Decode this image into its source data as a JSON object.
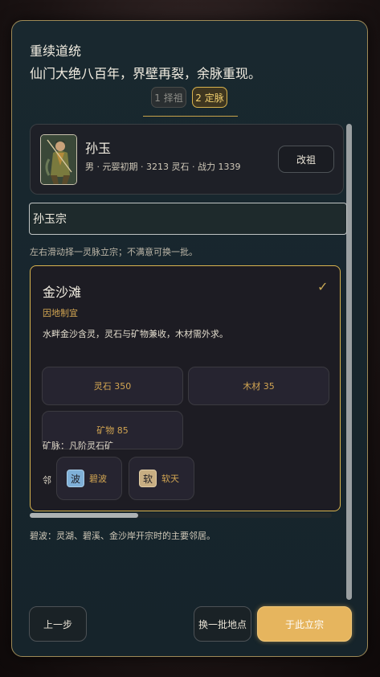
{
  "modal": {
    "title": "重续道统",
    "subtitle": "仙门大绝八百年，界壁再裂，余脉重现。"
  },
  "steps": [
    {
      "label": "1 择祖",
      "active": false
    },
    {
      "label": "2 定脉",
      "active": true
    }
  ],
  "founder": {
    "name": "孙玉",
    "meta": "男 · 元婴初期 · 3213 灵石 · 战力 1339",
    "change_label": "改祖"
  },
  "sect_name_input": {
    "value": "孙玉宗"
  },
  "hint": "左右滑动择一灵脉立宗；不满意可换一批。",
  "site": {
    "name": "金沙滩",
    "selected_mark": "✓",
    "tag": "因地制宜",
    "description": "水畔金沙含灵，灵石与矿物兼收，木材需外求。",
    "resources": [
      {
        "label": "灵石 350"
      },
      {
        "label": "木材 35"
      },
      {
        "label": "矿物 85"
      }
    ],
    "vein": "矿脉：凡阶灵石矿",
    "neighbor_label": "邻",
    "neighbors": [
      {
        "icon_char": "波",
        "icon_name": "wave-icon",
        "name": "碧波",
        "icon_color": "#7fb0d8"
      },
      {
        "icon_char": "软",
        "icon_name": "soft-icon",
        "name": "软天",
        "icon_color": "#c8ae82"
      }
    ]
  },
  "neighbor_note": "碧波：灵湖、碧溪、金沙岸开宗时的主要邻居。",
  "buttons": {
    "prev": "上一步",
    "reroll": "换一批地点",
    "confirm": "于此立宗"
  },
  "colors": {
    "accent_gold": "#d8b34e",
    "confirm_button": "#e6b55e",
    "panel_bg": "#19282f"
  }
}
